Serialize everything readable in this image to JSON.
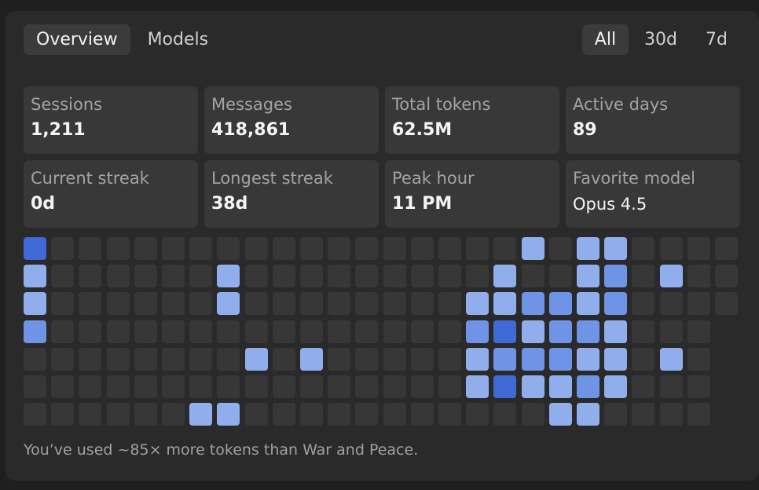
{
  "tabs": {
    "left": [
      {
        "label": "Overview",
        "active": true
      },
      {
        "label": "Models",
        "active": false
      }
    ],
    "right": [
      {
        "label": "All",
        "active": true
      },
      {
        "label": "30d",
        "active": false
      },
      {
        "label": "7d",
        "active": false
      }
    ]
  },
  "stats": [
    {
      "label": "Sessions",
      "value": "1,211"
    },
    {
      "label": "Messages",
      "value": "418,861"
    },
    {
      "label": "Total tokens",
      "value": "62.5M"
    },
    {
      "label": "Active days",
      "value": "89"
    },
    {
      "label": "Current streak",
      "value": "0d"
    },
    {
      "label": "Longest streak",
      "value": "38d"
    },
    {
      "label": "Peak hour",
      "value": "11 PM"
    },
    {
      "label": "Favorite model",
      "value": "Opus 4.5"
    }
  ],
  "heatmap": {
    "colors": {
      "0": "#373737",
      "1": "#91aeec",
      "2": "#6f94e6",
      "3": "#3f6ad6"
    },
    "rows": [
      [
        3,
        0,
        0,
        0,
        0,
        0,
        0,
        0,
        0,
        0,
        0,
        0,
        0,
        0,
        0,
        0,
        0,
        0,
        1,
        0,
        1,
        1,
        0,
        0,
        0,
        0
      ],
      [
        1,
        0,
        0,
        0,
        0,
        0,
        0,
        1,
        0,
        0,
        0,
        0,
        0,
        0,
        0,
        0,
        0,
        1,
        0,
        0,
        1,
        2,
        0,
        1,
        0,
        0
      ],
      [
        1,
        0,
        0,
        0,
        0,
        0,
        0,
        1,
        0,
        0,
        0,
        0,
        0,
        0,
        0,
        0,
        1,
        1,
        2,
        2,
        1,
        2,
        0,
        0,
        0,
        0
      ],
      [
        2,
        0,
        0,
        0,
        0,
        0,
        0,
        0,
        0,
        0,
        0,
        0,
        0,
        0,
        0,
        0,
        2,
        3,
        1,
        2,
        2,
        1,
        0,
        0,
        0,
        null
      ],
      [
        0,
        0,
        0,
        0,
        0,
        0,
        0,
        0,
        1,
        0,
        1,
        0,
        0,
        0,
        0,
        0,
        1,
        2,
        2,
        2,
        1,
        1,
        0,
        1,
        0,
        null
      ],
      [
        0,
        0,
        0,
        0,
        0,
        0,
        0,
        0,
        0,
        0,
        0,
        0,
        0,
        0,
        0,
        0,
        1,
        3,
        1,
        1,
        2,
        1,
        0,
        0,
        0,
        null
      ],
      [
        0,
        0,
        0,
        0,
        0,
        0,
        1,
        1,
        0,
        0,
        0,
        0,
        0,
        0,
        0,
        0,
        0,
        0,
        0,
        1,
        1,
        0,
        0,
        0,
        0,
        null
      ]
    ]
  },
  "footer": "You’ve used ~85× more tokens than War and Peace."
}
